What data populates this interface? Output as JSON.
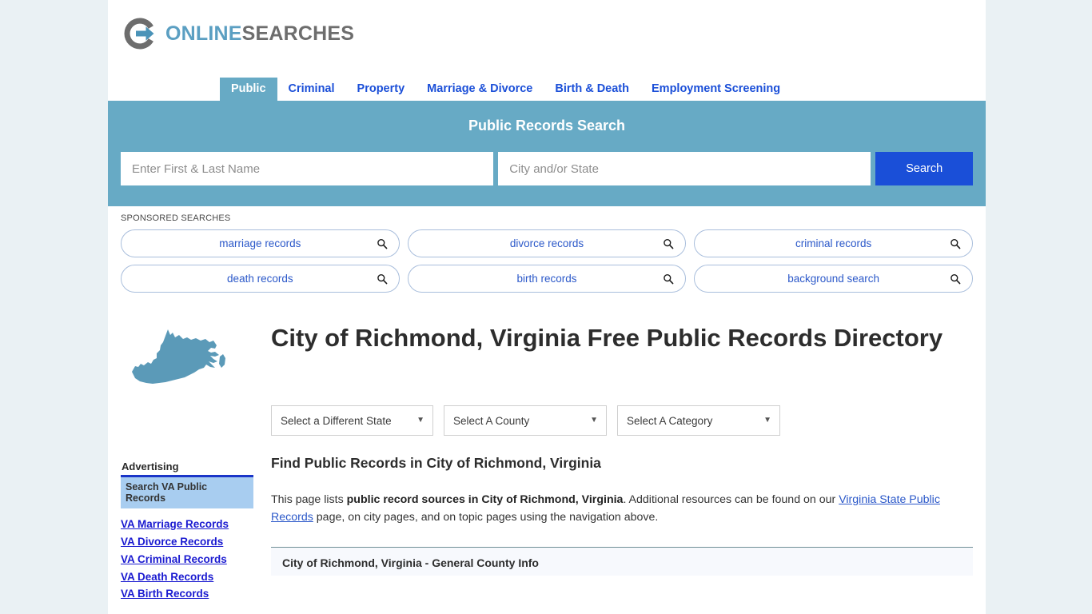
{
  "site": {
    "logo_primary": "ONLINE",
    "logo_secondary": "SEARCHES",
    "logo_icon": "circle-arrow-icon",
    "accent_blue": "#5b9fc2",
    "band_blue": "#67aac5",
    "link_blue": "#2b58c9",
    "button_blue": "#1a4fd8"
  },
  "nav": {
    "items": [
      {
        "label": "Public",
        "active": true
      },
      {
        "label": "Criminal",
        "active": false
      },
      {
        "label": "Property",
        "active": false
      },
      {
        "label": "Marriage & Divorce",
        "active": false
      },
      {
        "label": "Birth & Death",
        "active": false
      },
      {
        "label": "Employment Screening",
        "active": false
      }
    ]
  },
  "search": {
    "title": "Public Records Search",
    "name_placeholder": "Enter First & Last Name",
    "name_value": "",
    "location_placeholder": "City and/or State",
    "location_value": "",
    "button_label": "Search"
  },
  "sponsored": {
    "label": "SPONSORED SEARCHES",
    "items": [
      {
        "label": "marriage records",
        "icon": "search-icon"
      },
      {
        "label": "divorce records",
        "icon": "search-icon"
      },
      {
        "label": "criminal records",
        "icon": "search-icon"
      },
      {
        "label": "death records",
        "icon": "search-icon"
      },
      {
        "label": "birth records",
        "icon": "search-icon"
      },
      {
        "label": "background search",
        "icon": "search-icon"
      }
    ]
  },
  "page": {
    "state_map_icon": "virginia-state-map-icon",
    "title": "City of Richmond, Virginia Free Public Records Directory",
    "selects": [
      {
        "label": "Select a Different State",
        "caret": "▼"
      },
      {
        "label": "Select A County",
        "caret": "▼"
      },
      {
        "label": "Select A Category",
        "caret": "▼"
      }
    ],
    "section_heading": "Find Public Records in City of Richmond, Virginia",
    "intro": {
      "part1": "This page lists ",
      "bold": "public record sources in City of Richmond, Virginia",
      "part2": ". Additional resources can be found on our ",
      "link": "Virginia State Public Records",
      "part3": " page, on city pages, and on topic pages using the navigation above."
    },
    "table_heading": "City of Richmond, Virginia - General County Info"
  },
  "sidebar": {
    "ad_title": "Advertising",
    "ad_box_label": "Search VA Public Records",
    "links": [
      "VA Marriage Records",
      "VA Divorce Records",
      "VA Criminal Records",
      "VA Death Records",
      "VA Birth Records"
    ]
  }
}
